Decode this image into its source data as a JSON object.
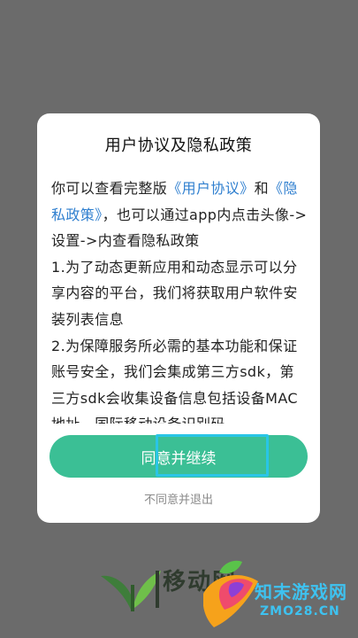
{
  "dialog": {
    "title": "用户协议及隐私政策",
    "content": {
      "line1_prefix": "你可以查看完整版",
      "user_agreement_link": "《用户协议》",
      "line1_suffix": "和",
      "privacy_link": "《隐私政策》",
      "line2_suffix": "，也可以通过app内点击头像->设置->内查看隐私政策",
      "item1": "1.为了动态更新应用和动态显示可以分享内容的平台，我们将获取用户软件安装列表信息",
      "item2": "2.为保障服务所必需的基本功能和保证账号安全，我们会集成第三方sdk，第三方sdk会收集设备信息包括设备MAC地址、国际移动设备识别码"
    },
    "agree_label": "同意并继续",
    "decline_label": "不同意并退出"
  },
  "watermark": {
    "left_text": "移动网",
    "site_name": "知末游戏网",
    "site_domain": "ZMO28.CN"
  },
  "colors": {
    "accent": "#3bbf95",
    "link": "#2f7fcf",
    "overlay": "#6b6b6b"
  }
}
